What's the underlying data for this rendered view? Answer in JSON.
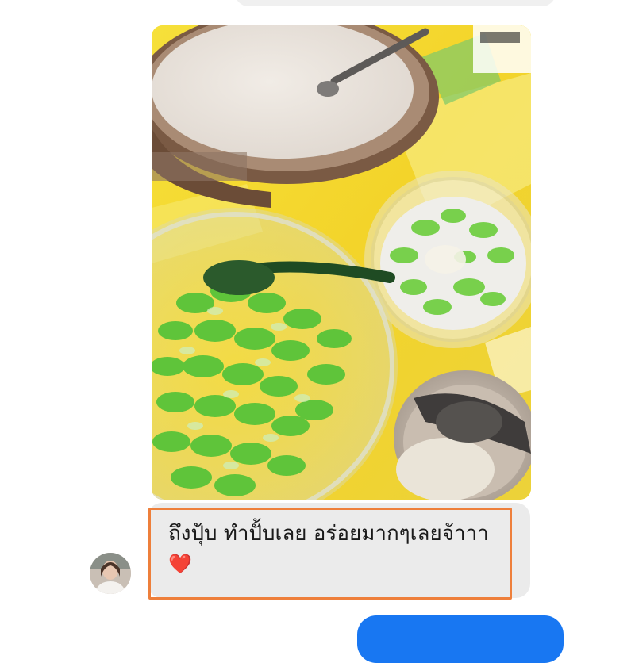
{
  "chat": {
    "message": {
      "text": "ถึงปุ้บ ทำปั้บเลย อร่อยมากๆเลยจ้าาา",
      "emoji": "❤️"
    },
    "avatar_icon": "user-avatar-icon",
    "colors": {
      "highlight_border": "#ee7f3b",
      "bubble_gray": "#ebebeb",
      "bubble_blue": "#1877f2",
      "heart": "#e0182d"
    }
  },
  "photo": {
    "icon": "food-photo-icon"
  }
}
